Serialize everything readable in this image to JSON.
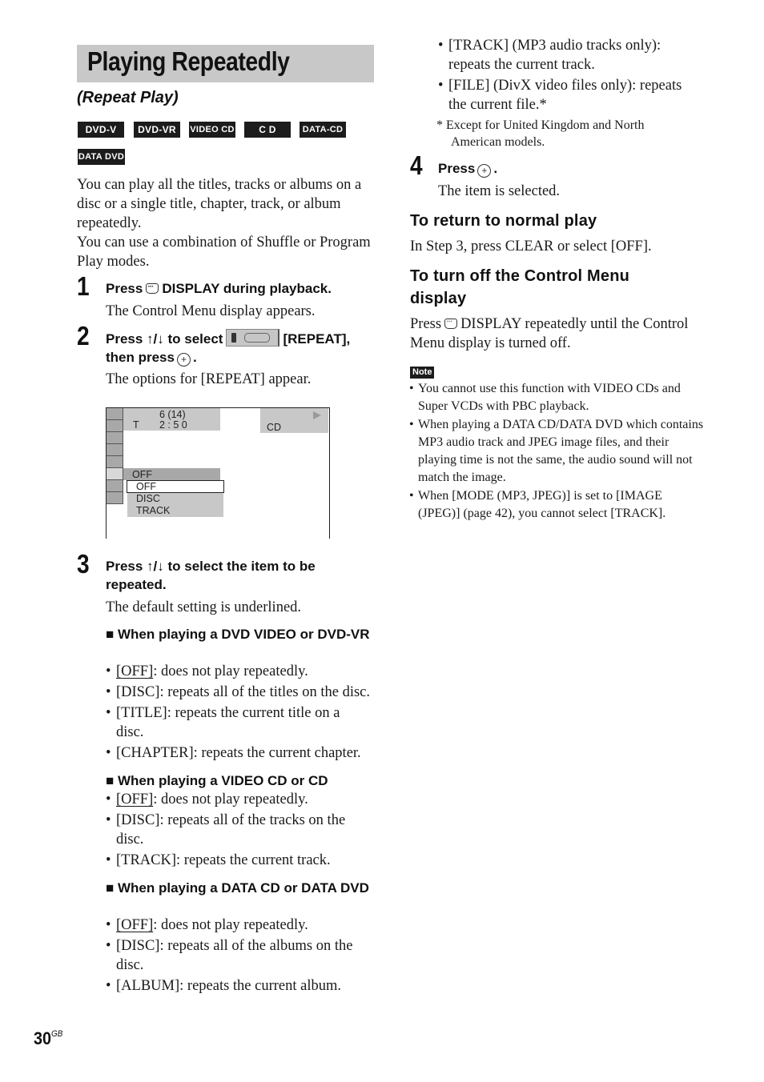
{
  "page": {
    "title": "Playing Repeatedly",
    "subtitle": "(Repeat Play)",
    "page_number": "30",
    "page_suffix": "GB"
  },
  "disc_badges": [
    "DVD-V",
    "DVD-VR",
    "VIDEO CD",
    "C D",
    "DATA-CD",
    "DATA DVD"
  ],
  "intro": [
    "You can play all the titles, tracks or albums on a disc or a single title, chapter, track, or album repeatedly.",
    "You can use a combination of Shuffle or Program Play modes."
  ],
  "steps": [
    {
      "num": "1",
      "head_a": "Press",
      "head_b": "DISPLAY during playback.",
      "icon": "display-icon",
      "desc": "The Control Menu display appears."
    },
    {
      "num": "2",
      "head_a": "Press ↑/↓ to select",
      "head_b": "[REPEAT],",
      "head_c": "then press",
      "icon": "repeat-icon",
      "desc": "The options for [REPEAT] appear."
    },
    {
      "num": "3",
      "head": "Press ↑/↓ to select the item to be repeated.",
      "desc": "The default setting is underlined."
    },
    {
      "num": "4",
      "head_a": "Press",
      "icon": "enter-icon",
      "desc": "The item is selected."
    }
  ],
  "osd": {
    "chapter": "6 (14)",
    "time_label": "T",
    "time": "2 : 5 0",
    "media": "CD",
    "current_value": "OFF",
    "options": [
      "OFF",
      "DISC",
      "TRACK"
    ],
    "selected_option": "OFF",
    "play_icon": "play-icon"
  },
  "sections": [
    {
      "head": "■ When playing a DVD VIDEO or DVD-VR",
      "items": [
        {
          "key": "[OFF]",
          "text": ": does not play repeatedly.",
          "default": true
        },
        {
          "key": "[DISC]",
          "text": ": repeats all of the titles on the disc."
        },
        {
          "key": "[TITLE]",
          "text": ": repeats the current title on a disc."
        },
        {
          "key": "[CHAPTER]",
          "text": ": repeats the current chapter."
        }
      ]
    },
    {
      "head": "■ When playing a VIDEO CD or CD",
      "items": [
        {
          "key": "[OFF]",
          "text": ": does not play repeatedly.",
          "default": true
        },
        {
          "key": "[DISC]",
          "text": ": repeats all of the tracks on the disc."
        },
        {
          "key": "[TRACK]",
          "text": ": repeats the current track."
        }
      ]
    },
    {
      "head": "■ When playing a DATA CD or DATA DVD",
      "items": [
        {
          "key": "[OFF]",
          "text": ": does not play repeatedly.",
          "default": true
        },
        {
          "key": "[DISC]",
          "text": ": repeats all of the albums on the disc."
        },
        {
          "key": "[ALBUM]",
          "text": ": repeats the current album."
        },
        {
          "key": "[TRACK]",
          "text": " (MP3 audio tracks only): repeats the current track."
        },
        {
          "key": "[FILE]",
          "text": " (DivX video files only): repeats the current file.*"
        }
      ],
      "footnote": "*  Except for United Kingdom and North American models."
    }
  ],
  "return_normal": {
    "head": "To return to normal play",
    "text": "In Step 3, press CLEAR or select [OFF]."
  },
  "turn_off": {
    "head": "To turn off the Control Menu display",
    "text_a": "Press",
    "text_b": "DISPLAY repeatedly until the Control Menu display is turned off."
  },
  "note": {
    "label": "Note",
    "items": [
      "You cannot use this function with VIDEO CDs and Super VCDs with PBC playback.",
      "When playing a DATA CD/DATA DVD which contains MP3 audio track and JPEG image files, and their playing time is not the same, the audio sound will not match the image.",
      "When [MODE (MP3, JPEG)] is set to [IMAGE (JPEG)] (page 42), you cannot select [TRACK]."
    ]
  }
}
